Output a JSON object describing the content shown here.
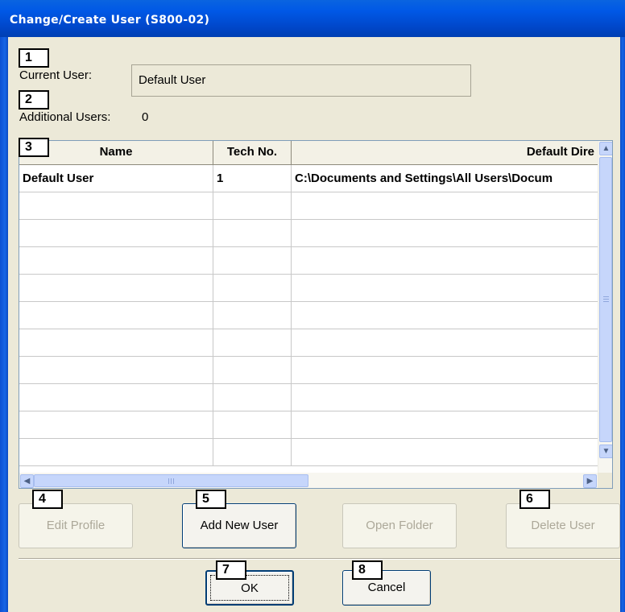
{
  "window": {
    "title": "Change/Create User (S800-02)"
  },
  "current_user": {
    "label": "Current User:",
    "value": "Default User"
  },
  "additional_users": {
    "label": "Additional Users:",
    "count": "0"
  },
  "user_table": {
    "columns": [
      "Name",
      "Tech No.",
      "Default Dire"
    ],
    "rows": [
      {
        "name": "Default User",
        "tech_no": "1",
        "default_directory": "C:\\Documents and Settings\\All Users\\Docum"
      }
    ],
    "empty_rows": 10
  },
  "buttons": {
    "edit_profile": "Edit Profile",
    "add_new_user": "Add New User",
    "open_folder": "Open Folder",
    "delete_user": "Delete User",
    "ok": "OK",
    "cancel": "Cancel"
  },
  "callouts": [
    "1",
    "2",
    "3",
    "4",
    "5",
    "6",
    "7",
    "8"
  ],
  "icons": {
    "scroll_up": "arrow-up-icon",
    "scroll_down": "arrow-down-icon",
    "scroll_left": "arrow-left-icon",
    "scroll_right": "arrow-right-icon"
  },
  "colors": {
    "title_bar": "#0054e3",
    "dialog_bg": "#ece9d8",
    "disabled_text": "#aca899"
  }
}
